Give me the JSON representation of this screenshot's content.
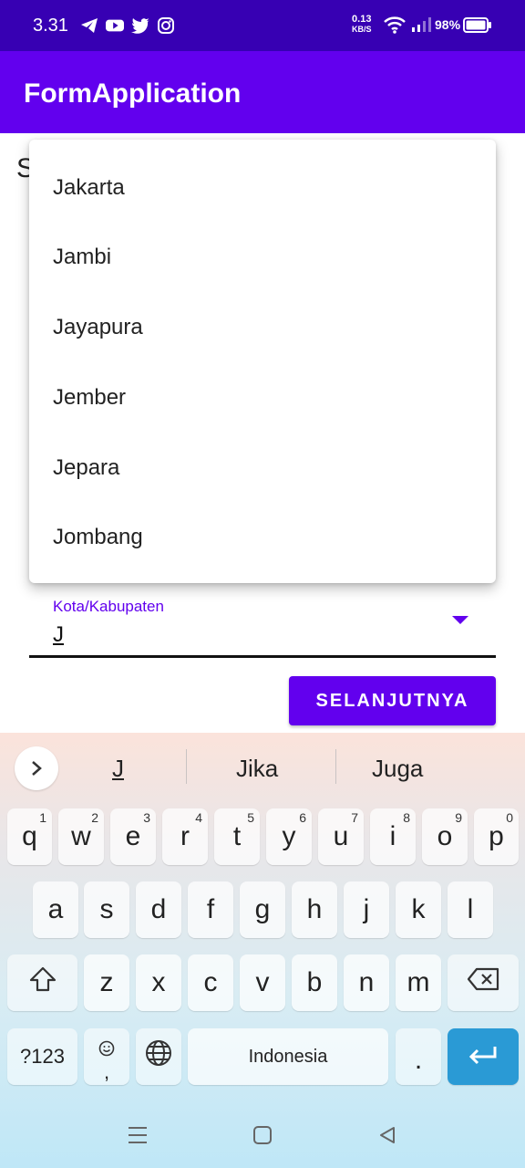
{
  "status_bar": {
    "time": "3.31",
    "net_speed_value": "0.13",
    "net_speed_unit": "KB/S",
    "battery": "98%",
    "icons": [
      "telegram-icon",
      "youtube-icon",
      "twitter-icon",
      "instagram-icon",
      "wifi-icon",
      "signal-icon",
      "battery-icon"
    ]
  },
  "app_bar": {
    "title": "FormApplication"
  },
  "background": {
    "partial_letter": "S"
  },
  "dropdown": {
    "items": [
      "Jakarta",
      "Jambi",
      "Jayapura",
      "Jember",
      "Jepara",
      "Jombang"
    ]
  },
  "city_field": {
    "label": "Kota/Kabupaten",
    "value": "J"
  },
  "next_button": {
    "label": "SELANJUTNYA"
  },
  "keyboard": {
    "suggestions": [
      "J",
      "Jika",
      "Juga"
    ],
    "row1": [
      {
        "key": "q",
        "hint": "1"
      },
      {
        "key": "w",
        "hint": "2"
      },
      {
        "key": "e",
        "hint": "3"
      },
      {
        "key": "r",
        "hint": "4"
      },
      {
        "key": "t",
        "hint": "5"
      },
      {
        "key": "y",
        "hint": "6"
      },
      {
        "key": "u",
        "hint": "7"
      },
      {
        "key": "i",
        "hint": "8"
      },
      {
        "key": "o",
        "hint": "9"
      },
      {
        "key": "p",
        "hint": "0"
      }
    ],
    "row2": [
      "a",
      "s",
      "d",
      "f",
      "g",
      "h",
      "j",
      "k",
      "l"
    ],
    "row3": [
      "z",
      "x",
      "c",
      "v",
      "b",
      "n",
      "m"
    ],
    "symbols_key": "?123",
    "emoji_comma": ",",
    "space_label": "Indonesia",
    "period": "."
  },
  "colors": {
    "status_bar": "#3700b3",
    "primary": "#6200ee",
    "enter_key": "#2a9ad5"
  }
}
